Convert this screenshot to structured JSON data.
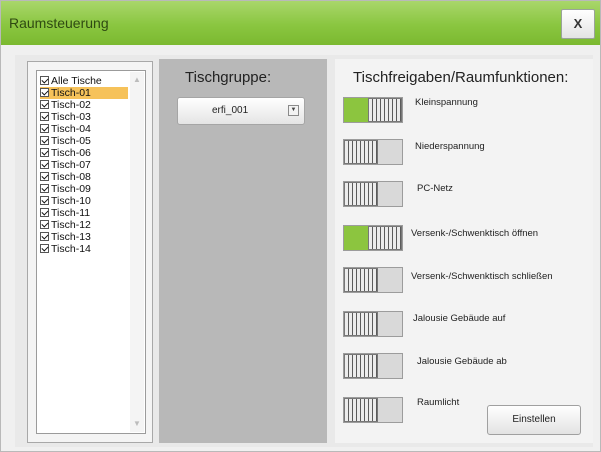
{
  "window": {
    "title": "Raumsteuerung",
    "close_label": "X"
  },
  "tables_list": {
    "items": [
      {
        "label": "Alle Tische",
        "checked": true,
        "selected": false
      },
      {
        "label": "Tisch-01",
        "checked": true,
        "selected": true
      },
      {
        "label": "Tisch-02",
        "checked": true,
        "selected": false
      },
      {
        "label": "Tisch-03",
        "checked": true,
        "selected": false
      },
      {
        "label": "Tisch-04",
        "checked": true,
        "selected": false
      },
      {
        "label": "Tisch-05",
        "checked": true,
        "selected": false
      },
      {
        "label": "Tisch-06",
        "checked": true,
        "selected": false
      },
      {
        "label": "Tisch-07",
        "checked": true,
        "selected": false
      },
      {
        "label": "Tisch-08",
        "checked": true,
        "selected": false
      },
      {
        "label": "Tisch-09",
        "checked": true,
        "selected": false
      },
      {
        "label": "Tisch-10",
        "checked": true,
        "selected": false
      },
      {
        "label": "Tisch-11",
        "checked": true,
        "selected": false
      },
      {
        "label": "Tisch-12",
        "checked": true,
        "selected": false
      },
      {
        "label": "Tisch-13",
        "checked": true,
        "selected": false
      },
      {
        "label": "Tisch-14",
        "checked": true,
        "selected": false
      }
    ],
    "scroll_up_icon": "triangle-up",
    "scroll_down_icon": "triangle-down"
  },
  "group": {
    "title": "Tischgruppe:",
    "selected": "erfi_001",
    "dropdown_icon": "chevron-down"
  },
  "functions": {
    "title": "Tischfreigaben/Raumfunktionen:",
    "items": [
      {
        "label": "Kleinspannung",
        "on": true
      },
      {
        "label": "Niederspannung",
        "on": false
      },
      {
        "label": "PC-Netz",
        "on": false
      },
      {
        "label": "Versenk-/Schwenktisch öffnen",
        "on": true
      },
      {
        "label": "Versenk-/Schwenktisch schließen",
        "on": false
      },
      {
        "label": "Jalousie Gebäude auf",
        "on": false
      },
      {
        "label": "Jalousie Gebäude ab",
        "on": false
      },
      {
        "label": "Raumlicht",
        "on": false
      }
    ],
    "settings_button": "Einstellen"
  },
  "colors": {
    "titlebar": "#8ac640",
    "toggle_on": "#8cc53f",
    "selected_item": "#f6c25a",
    "panel_gray": "#b8b8b8"
  }
}
